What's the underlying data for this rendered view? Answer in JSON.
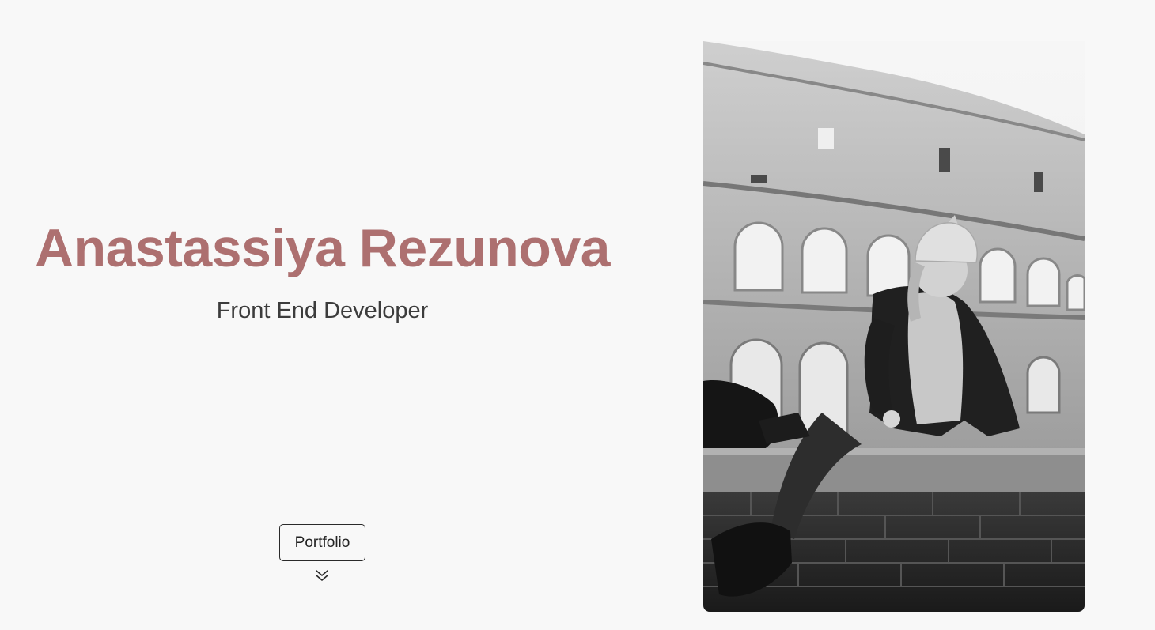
{
  "hero": {
    "name": "Anastassiya Rezunova",
    "role": "Front End Developer",
    "portfolio_label": "Portfolio",
    "scroll_icon": "chevron-double-down-icon"
  },
  "photo": {
    "style": "black-and-white",
    "icon": "profile-photo"
  },
  "colors": {
    "background": "#f8f8f8",
    "name_accent": "#ad7070",
    "role_text": "#3c3c3c",
    "button_border": "#2a2a2a"
  }
}
